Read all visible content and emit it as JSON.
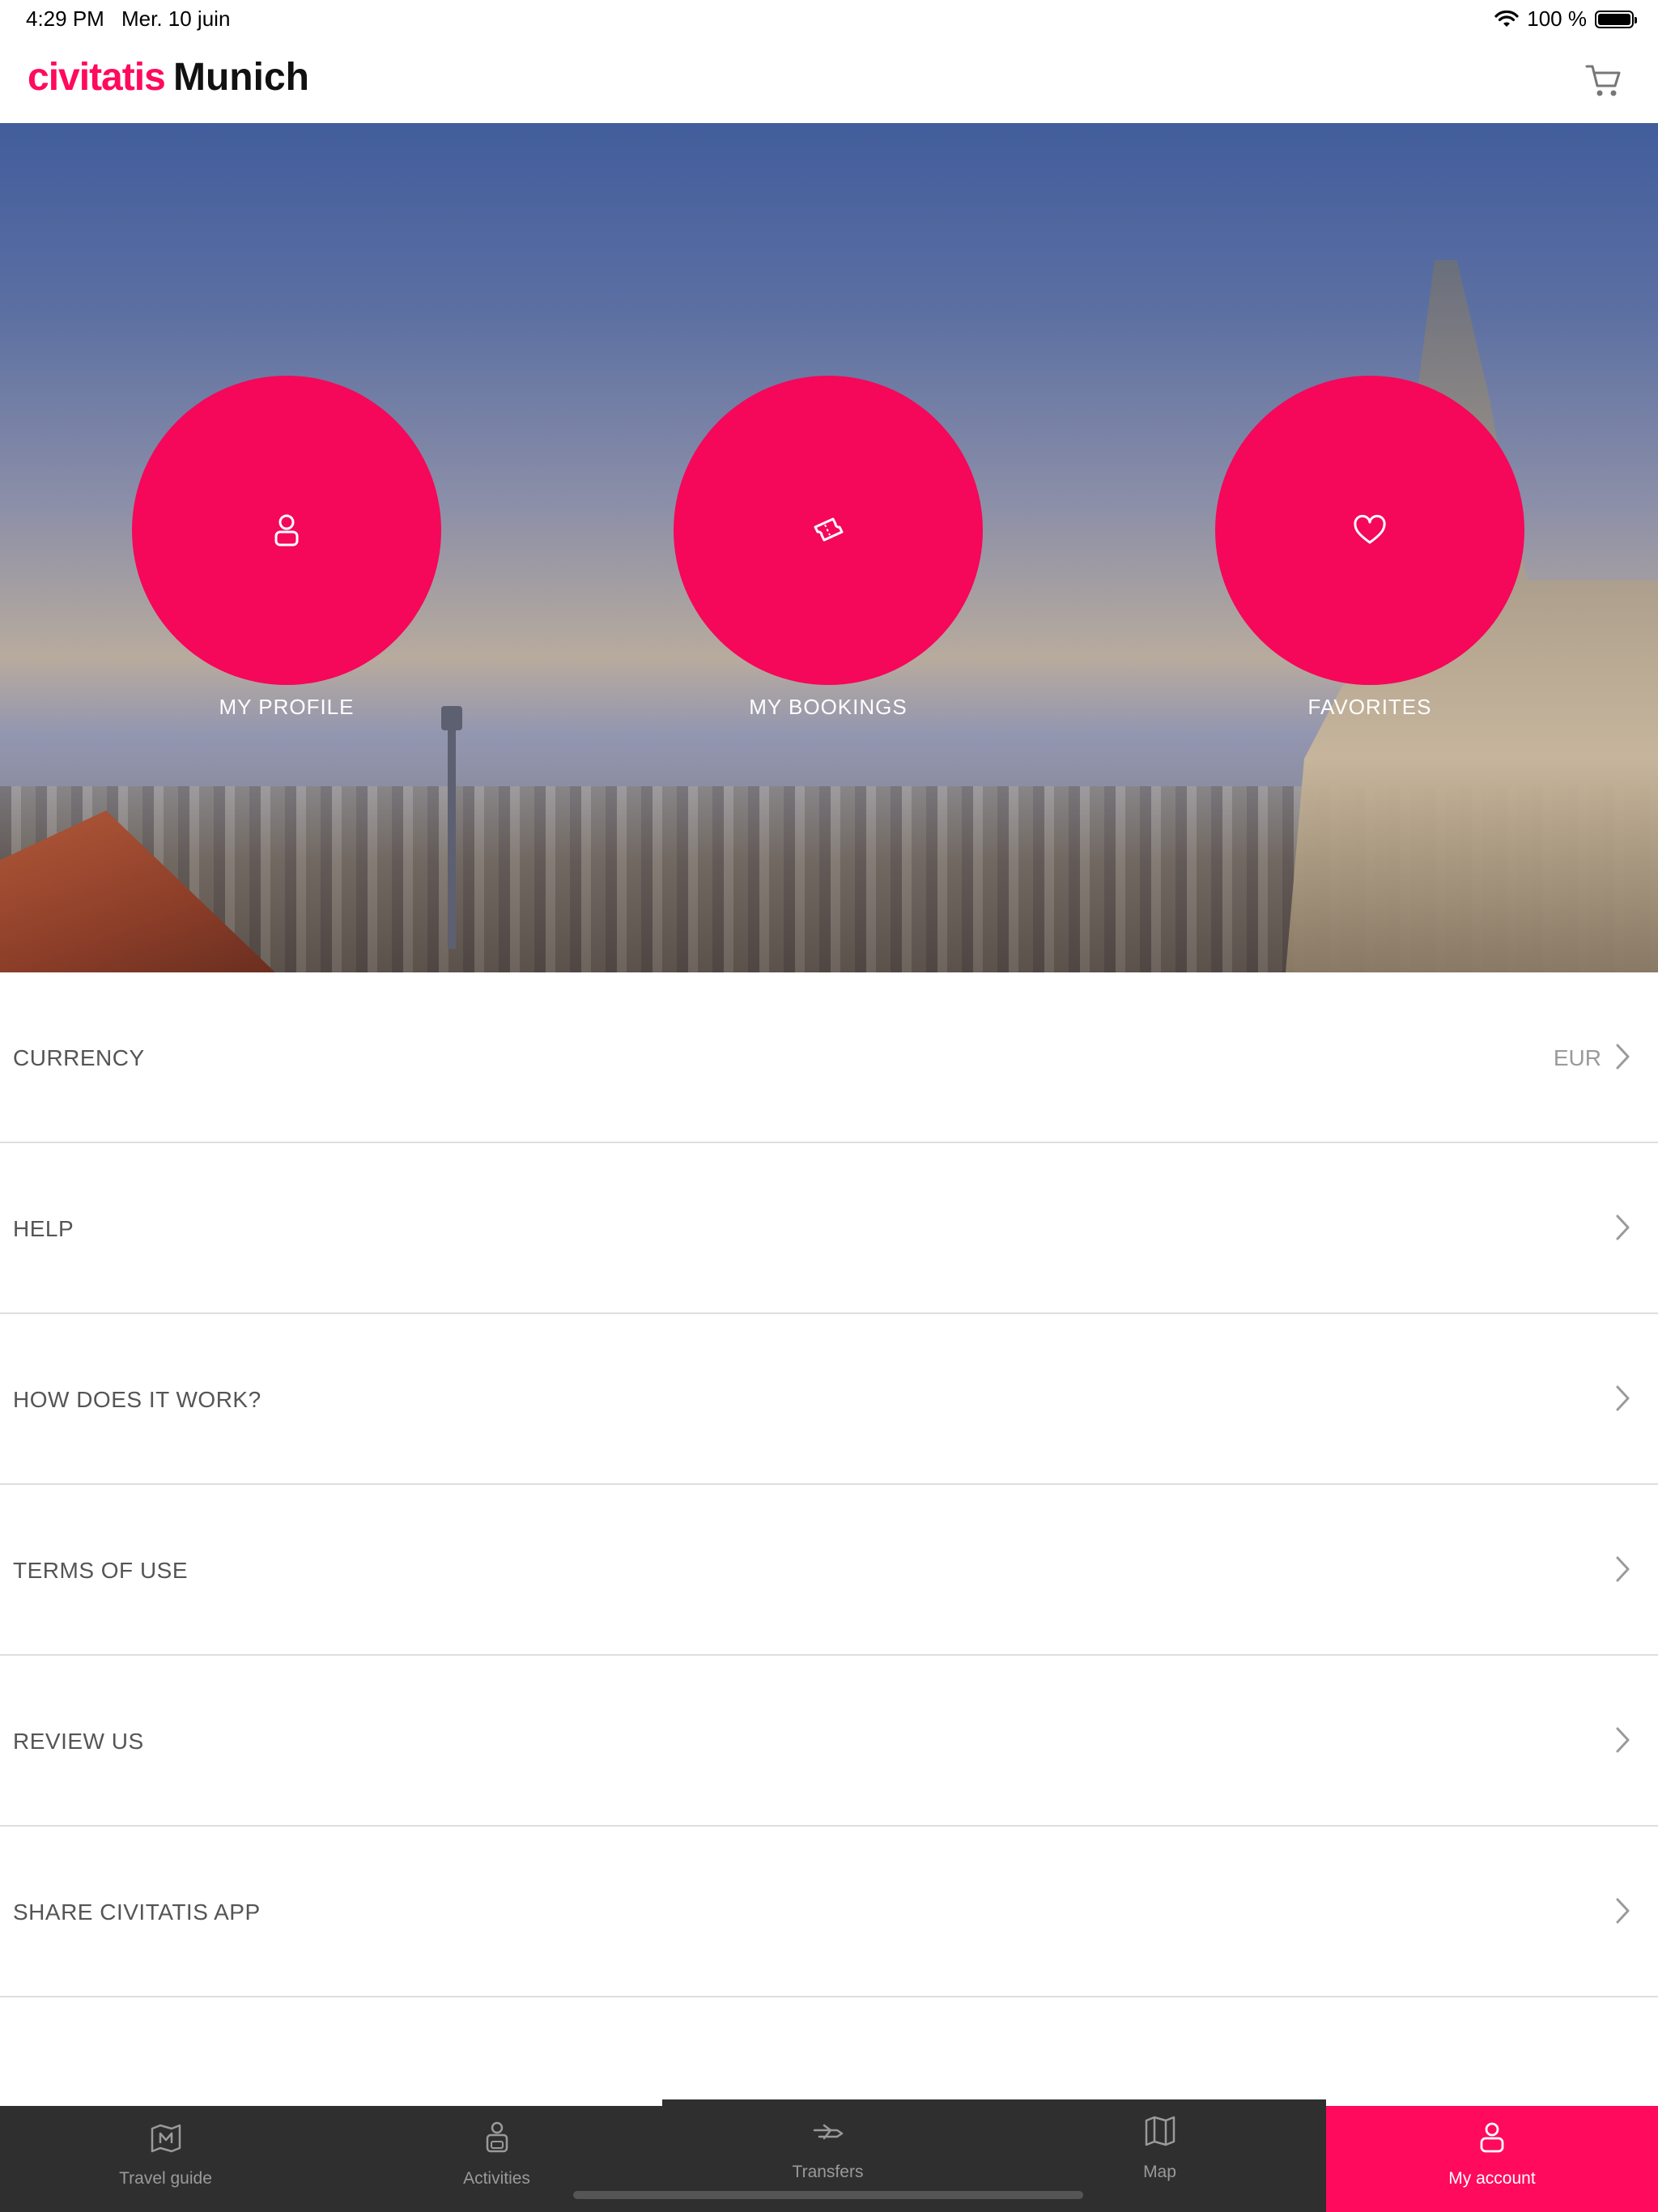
{
  "status_bar": {
    "time": "4:29 PM",
    "date": "Mer. 10 juin",
    "battery": "100 %"
  },
  "header": {
    "brand": "civitatis",
    "city": "Munich",
    "cart_icon": "cart-icon",
    "brand_color": "#ff0a5c"
  },
  "hero": {
    "actions": [
      {
        "label": "MY PROFILE",
        "icon": "user-icon"
      },
      {
        "label": "MY BOOKINGS",
        "icon": "ticket-icon"
      },
      {
        "label": "FAVORITES",
        "icon": "heart-icon"
      }
    ],
    "circle_color": "#f5075a"
  },
  "menu": {
    "items": [
      {
        "label": "CURRENCY",
        "value": "EUR"
      },
      {
        "label": "HELP"
      },
      {
        "label": "HOW DOES IT WORK?"
      },
      {
        "label": "TERMS OF USE"
      },
      {
        "label": "REVIEW US"
      },
      {
        "label": "SHARE CIVITATIS APP"
      }
    ]
  },
  "tabbar": {
    "tabs": [
      {
        "label": "Travel guide",
        "icon": "map-guide-icon"
      },
      {
        "label": "Activities",
        "icon": "activities-icon"
      },
      {
        "label": "Transfers",
        "icon": "transfers-icon"
      },
      {
        "label": "Map",
        "icon": "map-icon"
      },
      {
        "label": "My account",
        "icon": "user-icon",
        "active": true
      }
    ],
    "active_color": "#ff0a5c",
    "bar_color": "#2f2f2f"
  }
}
